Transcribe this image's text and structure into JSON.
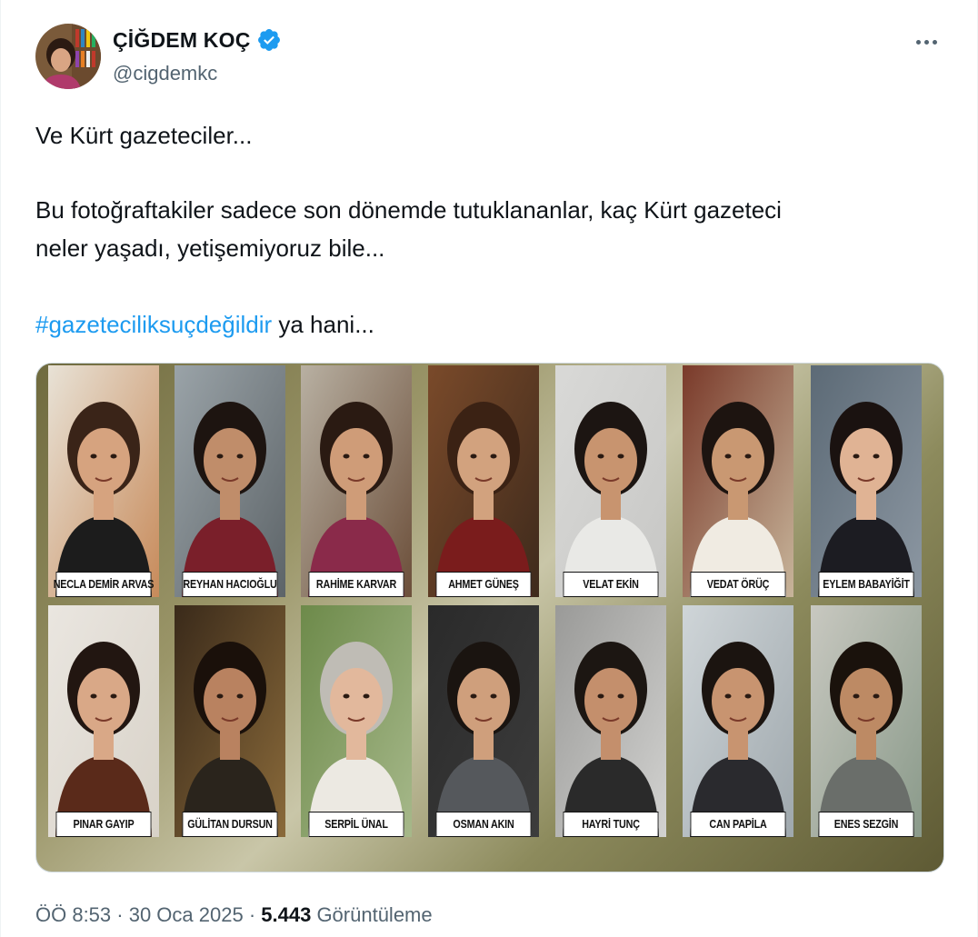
{
  "author": {
    "display_name": "ÇİĞDEM KOÇ",
    "handle": "@cigdemkc",
    "verified": true,
    "verified_color": "#1d9bf0"
  },
  "tweet": {
    "line1": "Ve Kürt gazeteciler...",
    "line2": "Bu fotoğraftakiler sadece son dönemde tutuklananlar, kaç Kürt gazeteci",
    "line3": "neler yaşadı, yetişemiyoruz bile...",
    "hashtag": "#gazeteciliksuçdeğildir",
    "after_hashtag": " ya hani...",
    "hashtag_color": "#1d9bf0"
  },
  "media": {
    "journalists_row1": [
      "NECLA DEMİR ARVAS",
      "REYHAN HACIOĞLU",
      "RAHİME KARVAR",
      "AHMET GÜNEŞ",
      "VELAT EKİN",
      "VEDAT ÖRÜÇ",
      "EYLEM BABAYİĞİT"
    ],
    "journalists_row2": [
      "PINAR GAYIP",
      "GÜLİTAN DURSUN",
      "SERPİL ÜNAL",
      "OSMAN AKIN",
      "HAYRİ TUNÇ",
      "CAN PAPİLA",
      "ENES SEZGİN"
    ]
  },
  "meta": {
    "time": "ÖÖ 8:53",
    "sep1": " · ",
    "date": "30 Oca 2025",
    "sep2": " · ",
    "views_count": "5.443",
    "views_label": " Görüntüleme"
  },
  "icons": {
    "verified": "verified-badge-icon",
    "more": "more-options-icon"
  }
}
